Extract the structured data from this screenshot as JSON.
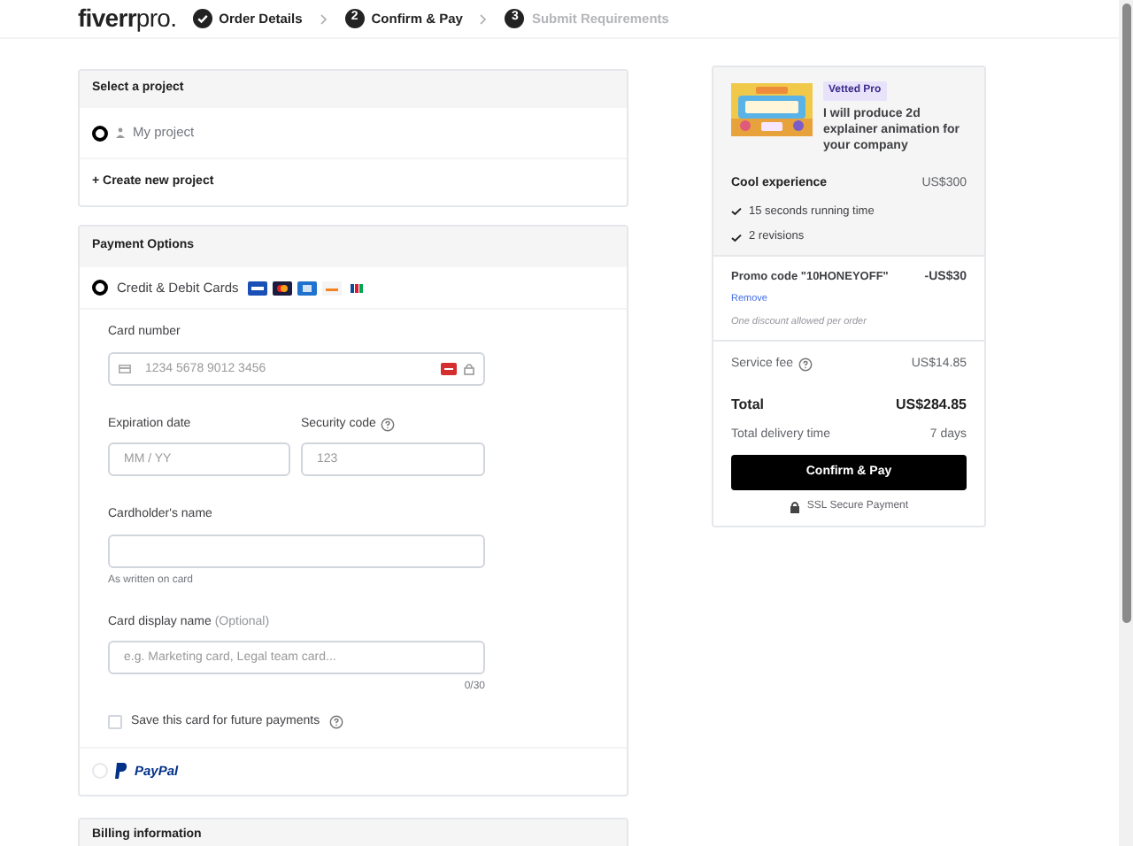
{
  "header": {
    "logo_main": "fiverr",
    "logo_suffix": "pro.",
    "steps": [
      {
        "label": "Order Details",
        "completed": true,
        "disabled": false
      },
      {
        "label": "Confirm & Pay",
        "number": "2",
        "completed": false,
        "disabled": false
      },
      {
        "label": "Submit Requirements",
        "number": "3",
        "completed": false,
        "disabled": true
      }
    ]
  },
  "project_card": {
    "title": "Select a project",
    "projects": [
      {
        "label": "My project",
        "selected": true
      }
    ],
    "create_link": "+ Create new project"
  },
  "payment_card": {
    "title": "Payment Options",
    "methods": [
      {
        "kind": "card",
        "label": "Credit & Debit Cards",
        "selected": true
      },
      {
        "kind": "paypal",
        "label": "PayPal",
        "selected": false
      }
    ],
    "card_number": {
      "label": "Card number",
      "placeholder": "1234 5678 9012 3456"
    },
    "expiration": {
      "label": "Expiration date",
      "placeholder": "MM / YY"
    },
    "security": {
      "label": "Security code",
      "placeholder": "123"
    },
    "cardholder": {
      "label": "Cardholder's name",
      "hint": "As written on card"
    },
    "display_name": {
      "label": "Card display name",
      "optional": "(Optional)",
      "placeholder": "e.g. Marketing card, Legal team card...",
      "counter": "0/30"
    },
    "save_card": {
      "label": "Save this card for future payments",
      "checked": false
    }
  },
  "billing_card": {
    "title": "Billing information"
  },
  "summary": {
    "badge": "Vetted Pro",
    "gig_title": "I will produce 2d explainer animation for your company",
    "package": {
      "name": "Cool experience",
      "price": "US$300",
      "features": [
        "15 seconds running time",
        "2 revisions"
      ]
    },
    "promo": {
      "label": "Promo code \"10HONEYOFF\"",
      "amount": "-US$30",
      "remove": "Remove",
      "note": "One discount allowed per order"
    },
    "service_fee": {
      "label": "Service fee",
      "amount": "US$14.85"
    },
    "total": {
      "label": "Total",
      "amount": "US$284.85"
    },
    "delivery": {
      "label": "Total delivery time",
      "value": "7 days"
    },
    "button": "Confirm & Pay",
    "secure_note": "SSL Secure Payment"
  }
}
